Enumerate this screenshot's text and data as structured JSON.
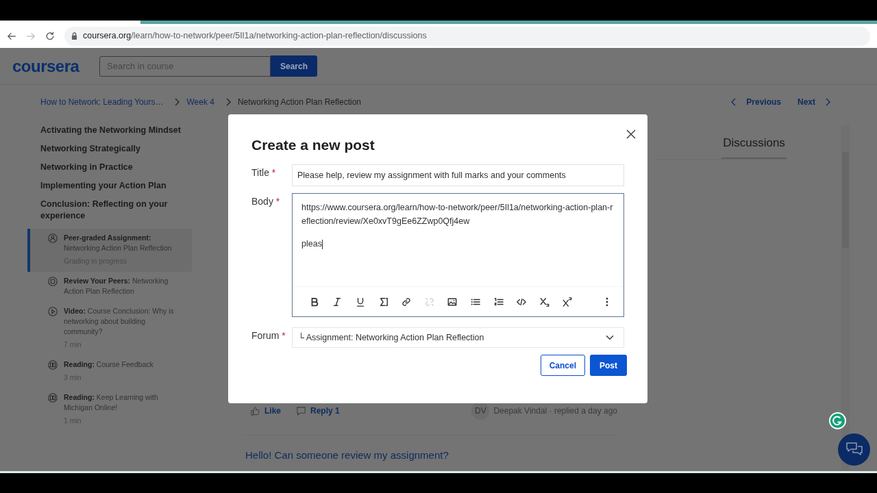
{
  "browser": {
    "forward_disabled": true,
    "url_host": "coursera.org",
    "url_path": "/learn/how-to-network/peer/5Il1a/networking-action-plan-reflection/discussions"
  },
  "header": {
    "logo": "coursera",
    "search": {
      "placeholder": "Search in course",
      "button": "Search"
    }
  },
  "breadcrumbs": [
    {
      "label": "How to Network: Leading Yours…",
      "kind": "link"
    },
    {
      "label": "Week 4",
      "kind": "link"
    },
    {
      "label": "Networking Action Plan Reflection",
      "kind": "current"
    }
  ],
  "pager": {
    "previous": "Previous",
    "next": "Next"
  },
  "sidebar": {
    "modules": [
      "Activating the Networking Mindset",
      "Networking Strategically",
      "Networking in Practice",
      "Implementing your Action Plan",
      "Conclusion: Reflecting on your experience"
    ],
    "items": [
      {
        "kind": "assignment",
        "text": "**Peer-graded Assignment:** Networking Action Plan Reflection",
        "meta": "Grading in progress",
        "selected": true
      },
      {
        "kind": "peer-review",
        "text": "**Review Your Peers:** Networking Action Plan Reflection",
        "selected": false
      },
      {
        "kind": "video",
        "text": "**Video:** Course Conclusion: Why is networking about building community?",
        "meta": "7 min",
        "selected": false
      },
      {
        "kind": "reading",
        "text": "**Reading:** Course Feedback",
        "meta": "3 min",
        "selected": false
      },
      {
        "kind": "reading",
        "text": "**Reading:** Keep Learning with Michigan Online!",
        "meta": "1 min",
        "selected": false
      }
    ]
  },
  "tabs": [
    {
      "label": "Discussions",
      "selected": true
    }
  ],
  "post": {
    "like": "Like",
    "reply": "Reply 1",
    "avatar": "DV",
    "byline": "Deepak Vindal · replied a day ago"
  },
  "next_post_title": "Hello! Can someone review my assignment?",
  "modal": {
    "title": "Create a new post",
    "title_field": {
      "label": "Title",
      "required_mark": "*",
      "value": "Please help, review my assignment with full marks and your comments"
    },
    "body_field": {
      "label": "Body",
      "required_mark": "*",
      "paragraphs": [
        "https://www.coursera.org/learn/how-to-network/peer/5Il1a/networking-action-plan-reflection/review/Xe0xvT9gEe6ZZwp0Qfj4ew",
        "pleas"
      ]
    },
    "toolbar": [
      {
        "kind": "bold",
        "disabled": false
      },
      {
        "kind": "italic",
        "disabled": false
      },
      {
        "kind": "underline",
        "disabled": false
      },
      {
        "kind": "math",
        "disabled": false
      },
      {
        "kind": "link",
        "disabled": false
      },
      {
        "kind": "unlink",
        "disabled": true
      },
      {
        "kind": "image",
        "disabled": false
      },
      {
        "kind": "bullets",
        "disabled": false
      },
      {
        "kind": "numbers",
        "disabled": false
      },
      {
        "kind": "code",
        "disabled": false
      },
      {
        "kind": "subscript",
        "disabled": false
      },
      {
        "kind": "superscript",
        "disabled": false
      },
      {
        "kind": "more",
        "disabled": false
      }
    ],
    "forum_field": {
      "label": "Forum",
      "required_mark": "*",
      "value": "└ Assignment: Networking Action Plan Reflection"
    },
    "buttons": {
      "cancel": "Cancel",
      "post": "Post"
    }
  }
}
